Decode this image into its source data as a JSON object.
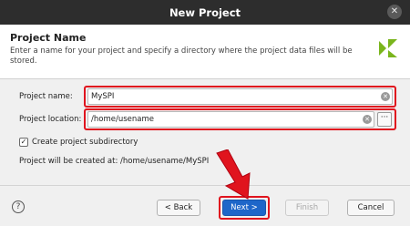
{
  "window": {
    "title": "New Project"
  },
  "header": {
    "title": "Project Name",
    "description": "Enter a name for your project and specify a directory where the project data files will be stored."
  },
  "form": {
    "project_name_label": "Project name:",
    "project_name_value": "MySPI",
    "project_location_label": "Project location:",
    "project_location_value": "/home/usename",
    "browse_label": "···",
    "create_subdir_label": "Create project subdirectory",
    "create_subdir_checked": true,
    "created_at_text": "Project will be created at: /home/usename/MySPI"
  },
  "footer": {
    "help_label": "?",
    "back_label": "< Back",
    "next_label": "Next >",
    "finish_label": "Finish",
    "cancel_label": "Cancel"
  },
  "colors": {
    "accent": "#1e66c9",
    "highlight": "#e0141e",
    "logo": "#7ab51d"
  },
  "icons": [
    "close-icon",
    "vivado-logo-icon",
    "clear-icon",
    "browse-icon",
    "check-icon",
    "help-icon",
    "red-arrow-icon"
  ]
}
